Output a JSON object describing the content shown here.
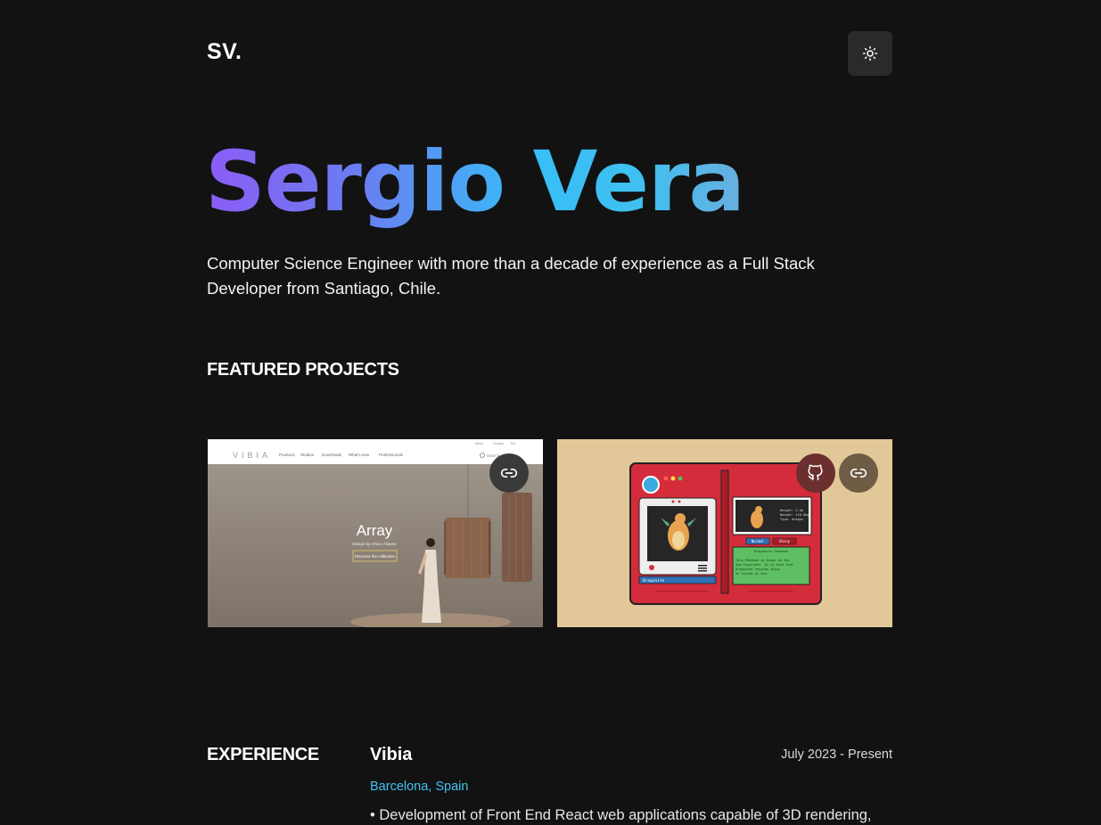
{
  "header": {
    "logo": "SV.",
    "theme_toggle_icon": "sun-icon"
  },
  "hero": {
    "name": "Sergio Vera",
    "description": "Computer Science Engineer with more than a decade of experience as a Full Stack Developer from Santiago, Chile.",
    "gradient_colors": [
      "#8b5cf6",
      "#38bdf8"
    ]
  },
  "featured": {
    "title": "FEATURED PROJECTS",
    "projects": [
      {
        "screenshot": {
          "brand": "VIBIA",
          "nav": [
            "Products",
            "Studios",
            "Downloads",
            "What's new",
            "Professionals"
          ],
          "top_links": [
            "About",
            "Contact",
            "EN"
          ],
          "search": "Search",
          "heading": "Array",
          "subheading": "Design by Arturo Álvarez",
          "cta": "Discover the collection"
        },
        "buttons": [
          "link-icon"
        ]
      },
      {
        "screenshot": {
          "entry_name": "Dragonite",
          "info_lines": [
            "Height: 2.2m",
            "Weight: 210.0kg",
            "Type: dragon"
          ],
          "tabs": [
            "Normal",
            "Shiny"
          ],
          "description_title": "Dragonite Pokemon",
          "description_lines": [
            "This Pokemon is known as the",
            "Sea Incarnate. It is said that",
            "Dragonite rescues ships",
            "in storms at sea."
          ]
        },
        "buttons": [
          "github-icon",
          "link-icon"
        ]
      }
    ]
  },
  "experience": {
    "title": "EXPERIENCE",
    "items": [
      {
        "company": "Vibia",
        "date": "July 2023 - Present",
        "location": "Barcelona, Spain",
        "bullet": "• Development of Front End React web applications capable of 3D rendering,"
      }
    ]
  }
}
